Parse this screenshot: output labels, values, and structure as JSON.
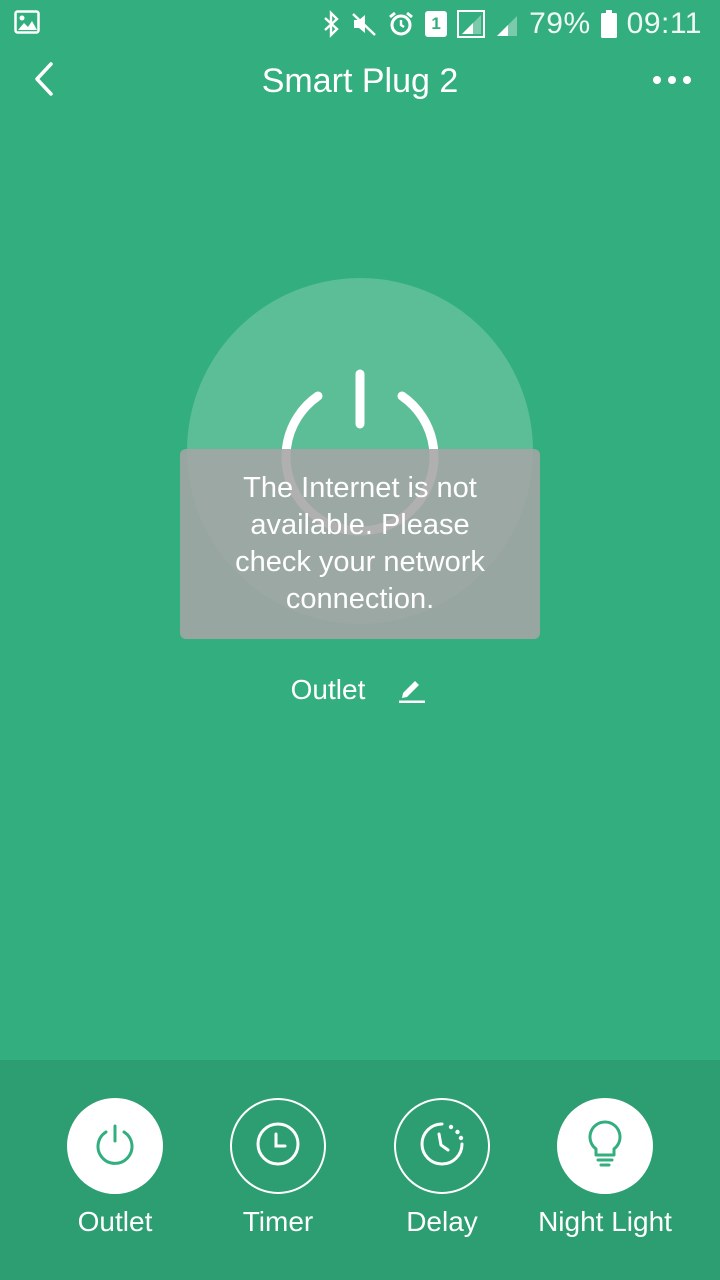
{
  "status_bar": {
    "battery": "79%",
    "time": "09:11",
    "sim_slot": "1",
    "icons": [
      "image-icon",
      "bluetooth-icon",
      "mute-icon",
      "alarm-icon",
      "sim-icon",
      "signal-icon",
      "signal-icon",
      "battery-icon"
    ]
  },
  "header": {
    "title": "Smart Plug 2",
    "back_icon": "chevron-left-icon",
    "more_icon": "more-horizontal-icon"
  },
  "power": {
    "icon": "power-icon"
  },
  "toast": {
    "message": "The Internet is not available. Please check your network connection."
  },
  "outlet": {
    "label": "Outlet",
    "edit_icon": "pencil-icon"
  },
  "tabs": [
    {
      "label": "Outlet",
      "icon": "power-icon",
      "active": true
    },
    {
      "label": "Timer",
      "icon": "clock-icon",
      "active": false
    },
    {
      "label": "Delay",
      "icon": "delay-clock-icon",
      "active": false
    },
    {
      "label": "Night Light",
      "icon": "lightbulb-icon",
      "active": true
    }
  ],
  "colors": {
    "background": "#33AE7E",
    "bottom_bar": "#2C9E72",
    "accent": "#33AE7E",
    "toast": "#A5A5A5"
  }
}
